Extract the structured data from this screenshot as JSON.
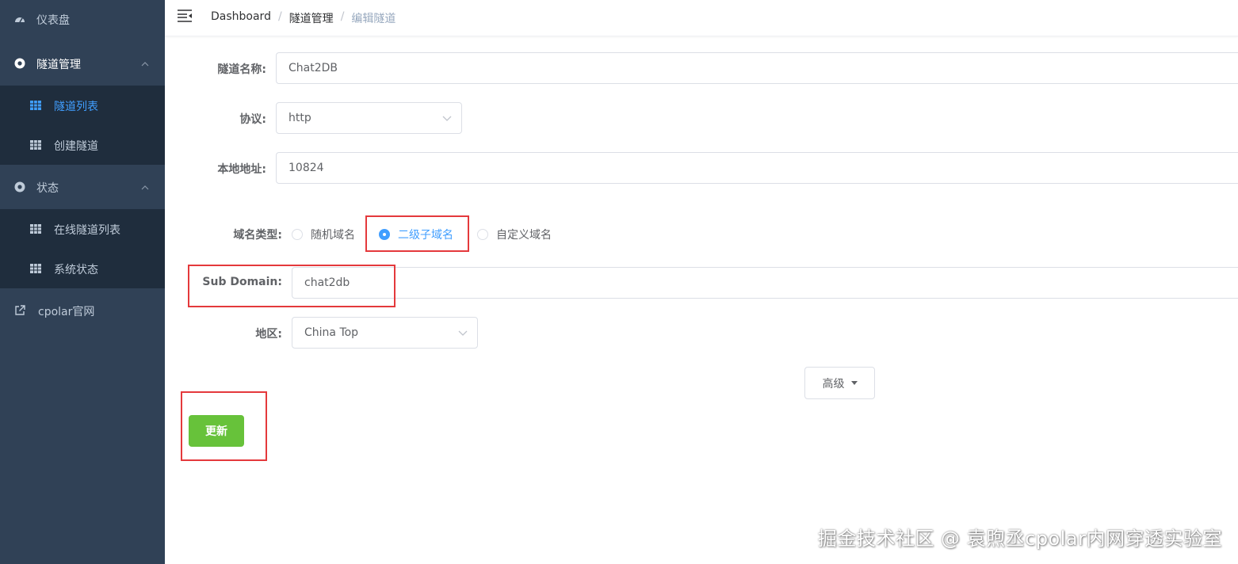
{
  "sidebar": {
    "dashboard": "仪表盘",
    "tunnel_mgmt": "隧道管理",
    "tunnel_list": "隧道列表",
    "create_tunnel": "创建隧道",
    "status": "状态",
    "online_tunnels": "在线隧道列表",
    "system_status": "系统状态",
    "cpolar_site": "cpolar官网"
  },
  "breadcrumb": [
    "Dashboard",
    "隧道管理",
    "编辑隧道"
  ],
  "form": {
    "name_label": "隧道名称:",
    "name_value": "Chat2DB",
    "protocol_label": "协议:",
    "protocol_value": "http",
    "local_label": "本地地址:",
    "local_value": "10824",
    "domain_type_label": "域名类型:",
    "domain_options": [
      "随机域名",
      "二级子域名",
      "自定义域名"
    ],
    "domain_selected": "二级子域名",
    "subdomain_label": "Sub Domain:",
    "subdomain_value": "chat2db",
    "region_label": "地区:",
    "region_value": "China Top",
    "advanced_label": "高级",
    "update_label": "更新"
  },
  "watermark": "掘金技术社区 @ 袁煦丞cpolar内网穿透实验室",
  "colors": {
    "sidebar_bg": "#304156",
    "submenu_bg": "#1f2d3d",
    "active": "#409eff",
    "primary_green": "#67c23a",
    "highlight_red": "#e4393c"
  }
}
